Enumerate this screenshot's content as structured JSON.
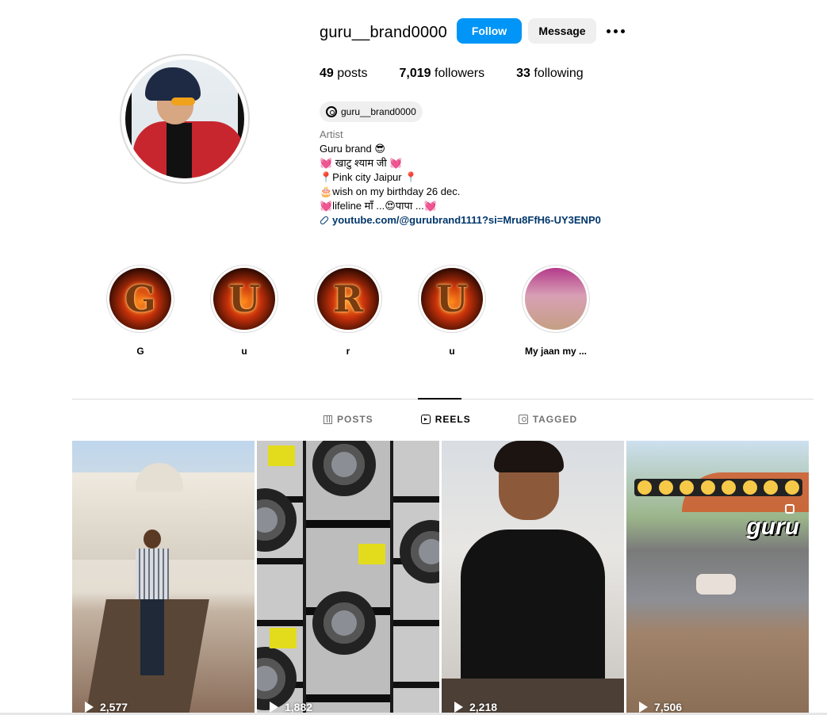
{
  "profile": {
    "username": "guru__brand0000",
    "follow_label": "Follow",
    "message_label": "Message",
    "stats": {
      "posts_count": "49",
      "posts_label": "posts",
      "followers_count": "7,019",
      "followers_label": "followers",
      "following_count": "33",
      "following_label": "following"
    },
    "threads_handle": "guru__brand0000",
    "bio": {
      "category": "Artist",
      "lines": [
        "Guru brand 😎",
        "💓 खाटु श्याम जी 💓",
        "📍Pink city Jaipur 📍",
        "🎂wish on my birthday 26 dec.",
        "💓lifeline माँ ...😍पापा ...💓"
      ],
      "link": "youtube.com/@gurubrand1111?si=Mru8FfH6-UY3ENP0"
    }
  },
  "highlights": [
    {
      "label": "G",
      "letter": "G"
    },
    {
      "label": "u",
      "letter": "U"
    },
    {
      "label": "r",
      "letter": "R"
    },
    {
      "label": "u",
      "letter": "U"
    },
    {
      "label": "My jaan my ...",
      "letter": ""
    }
  ],
  "tabs": [
    {
      "label": "POSTS",
      "icon": "grid-icon",
      "active": false
    },
    {
      "label": "REELS",
      "icon": "reels-icon",
      "active": true
    },
    {
      "label": "TAGGED",
      "icon": "tagged-icon",
      "active": false
    }
  ],
  "reels": [
    {
      "views": "2,577"
    },
    {
      "views": "1,882"
    },
    {
      "views": "2,218"
    },
    {
      "views": "7,506",
      "overlay_text": "guru"
    }
  ],
  "colors": {
    "follow_button": "#0095f6",
    "message_button": "#efefef",
    "link": "#00376b",
    "muted_text": "#737373"
  }
}
